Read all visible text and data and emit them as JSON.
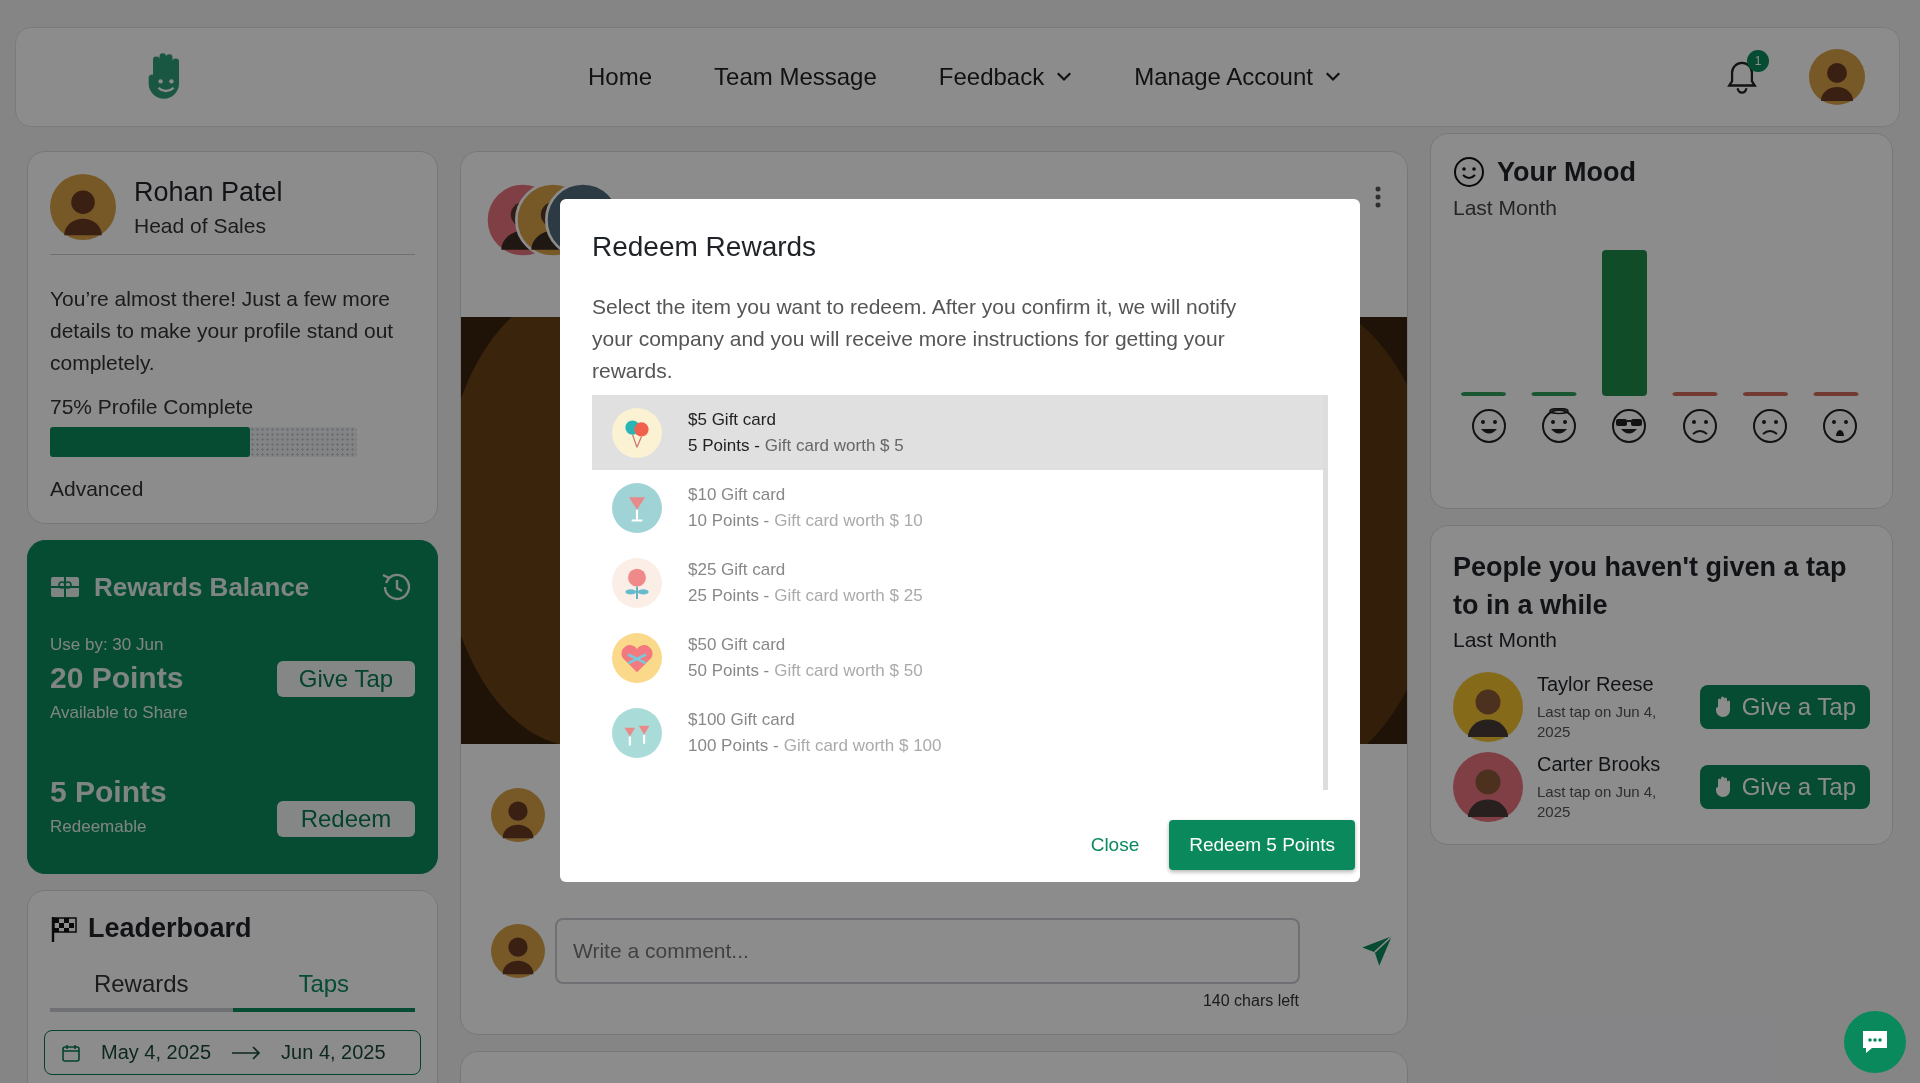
{
  "header": {
    "nav": [
      {
        "label": "Home",
        "has_menu": false
      },
      {
        "label": "Team Message",
        "has_menu": false
      },
      {
        "label": "Feedback",
        "has_menu": true
      },
      {
        "label": "Manage Account",
        "has_menu": true
      }
    ],
    "notification_count": "1"
  },
  "profile": {
    "name": "Rohan Patel",
    "title": "Head of Sales",
    "message": "You’re almost there! Just a few more details to make your profile stand out completely.",
    "progress_label": "75% Profile Complete",
    "level": 0.65,
    "tier": "Advanced"
  },
  "rewards": {
    "title": "Rewards Balance",
    "use_by": "Use by: 30 Jun",
    "share_points": "20 Points",
    "share_caption": "Available to Share",
    "give_button": "Give Tap",
    "redeem_points": "5 Points",
    "redeem_caption": "Redeemable",
    "redeem_button": "Redeem"
  },
  "leaderboard": {
    "title": "Leaderboard",
    "tabs": [
      {
        "label": "Rewards",
        "selected": false
      },
      {
        "label": "Taps",
        "selected": true
      }
    ],
    "date_from": "May 4, 2025",
    "date_to": "Jun 4, 2025"
  },
  "post": {
    "comment_placeholder": "Write a comment...",
    "chars_left": "140 chars left"
  },
  "mood": {
    "title": "Your Mood",
    "subtitle": "Last Month"
  },
  "people": {
    "title": "People you haven't given a tap to in a while",
    "subtitle": "Last Month",
    "items": [
      {
        "name": "Taylor Reese",
        "last_tap": "Last tap on Jun 4, 2025",
        "button": "Give a Tap"
      },
      {
        "name": "Carter Brooks",
        "last_tap": "Last tap on Jun 4, 2025",
        "button": "Give a Tap"
      }
    ]
  },
  "modal": {
    "title": "Redeem Rewards",
    "description": "Select the item you want to redeem. After you confirm it, we will notify your company and you will receive more instructions for getting your rewards.",
    "items": [
      {
        "title": "$5 Gift card",
        "points": "5 Points -",
        "detail": "Gift card worth $ 5",
        "selected": true
      },
      {
        "title": "$10 Gift card",
        "points": "10 Points -",
        "detail": "Gift card worth $ 10",
        "selected": false
      },
      {
        "title": "$25 Gift card",
        "points": "25 Points -",
        "detail": "Gift card worth $ 25",
        "selected": false
      },
      {
        "title": "$50 Gift card",
        "points": "50 Points -",
        "detail": "Gift card worth $ 50",
        "selected": false
      },
      {
        "title": "$100 Gift card",
        "points": "100 Points -",
        "detail": "Gift card worth $ 100",
        "selected": false
      }
    ],
    "close": "Close",
    "confirm": "Redeem 5 Points"
  }
}
